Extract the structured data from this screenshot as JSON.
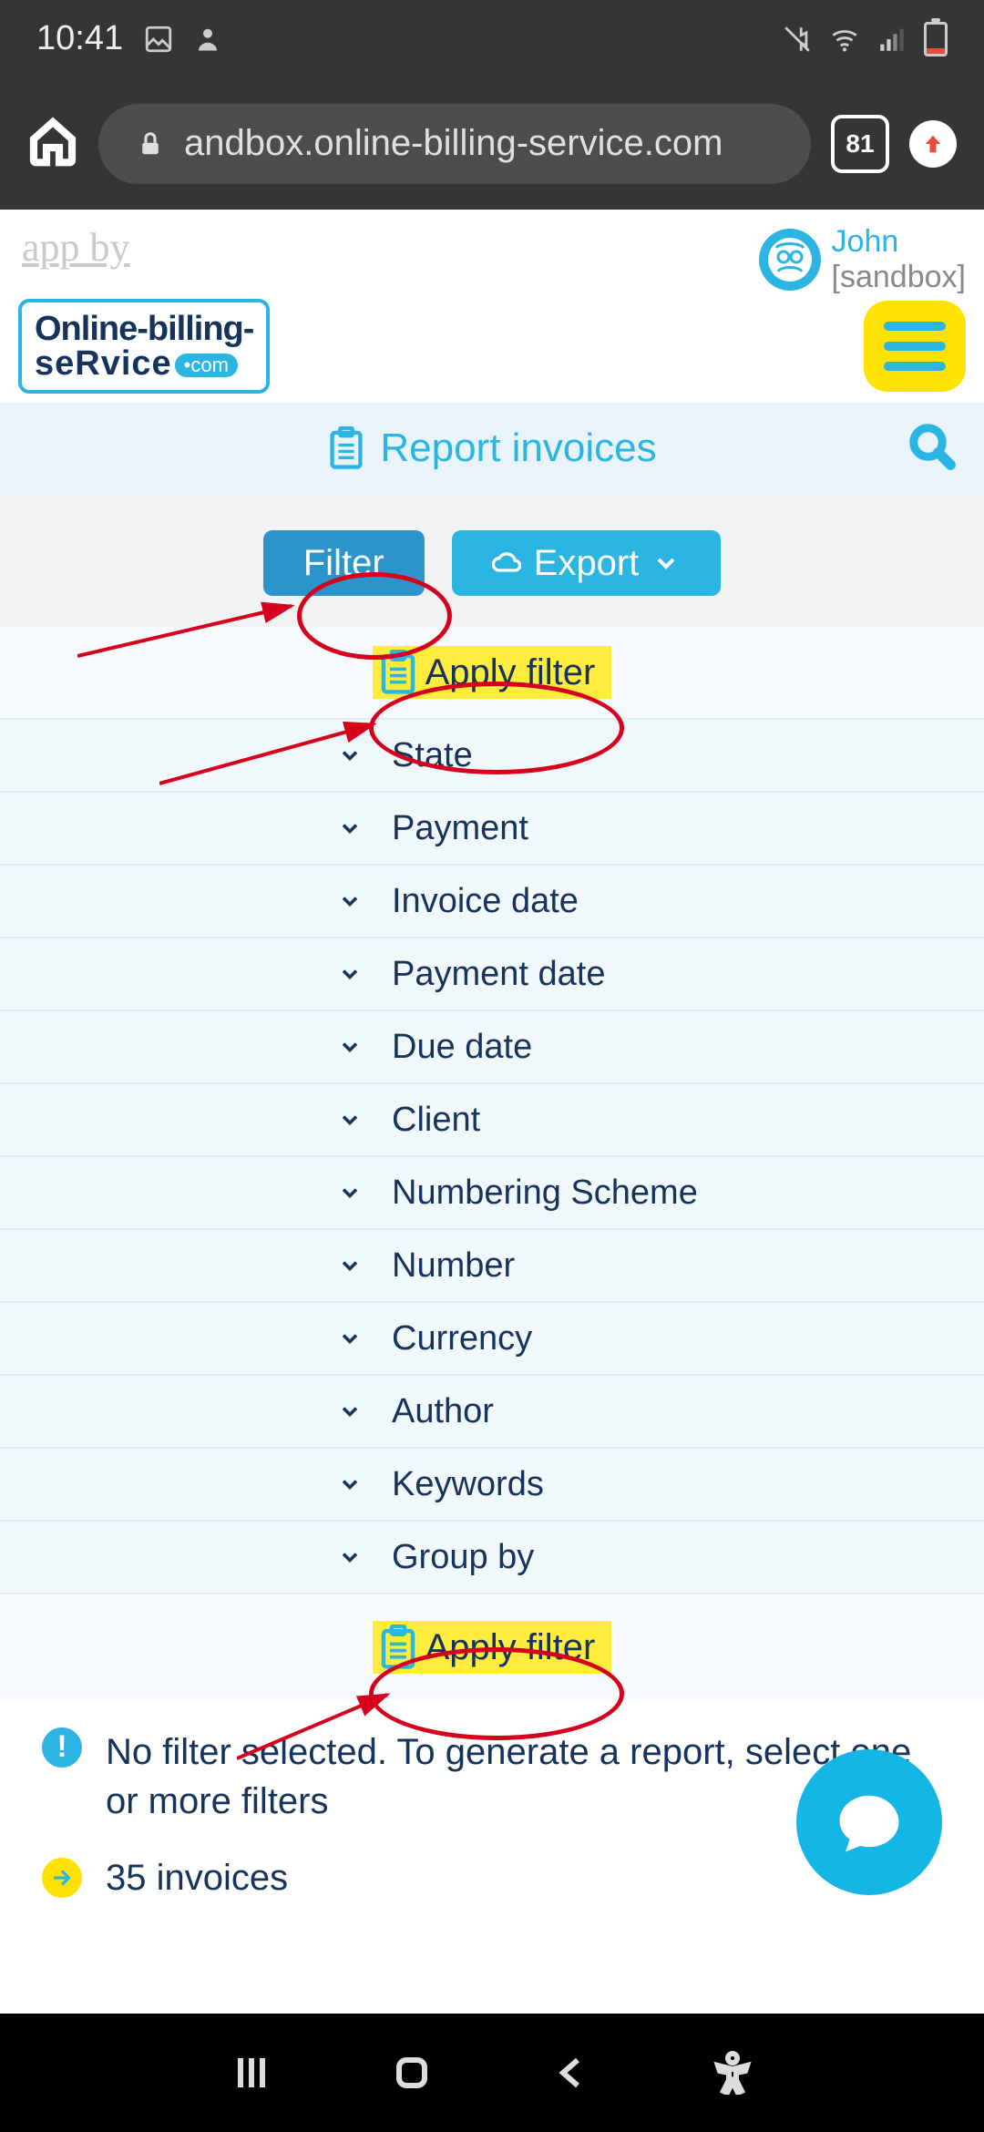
{
  "status": {
    "time": "10:41"
  },
  "browser": {
    "url": "andbox.online-billing-service.com",
    "tab_count": "81"
  },
  "header": {
    "app_by": "app by",
    "logo_line1": "Online-billing-",
    "logo_line2": "seRvice",
    "logo_com": "•com",
    "user_name": "John",
    "user_env": "[sandbox]"
  },
  "titlebar": {
    "title": "Report invoices"
  },
  "toolbar": {
    "filter": "Filter",
    "export": "Export"
  },
  "apply_filter": "Apply filter",
  "filters": [
    "State",
    "Payment",
    "Invoice date",
    "Payment date",
    "Due date",
    "Client",
    "Numbering Scheme",
    "Number",
    "Currency",
    "Author",
    "Keywords",
    "Group by"
  ],
  "info": {
    "no_filter": "No filter selected. To generate a report, select one or more filters",
    "count": "35 invoices"
  }
}
